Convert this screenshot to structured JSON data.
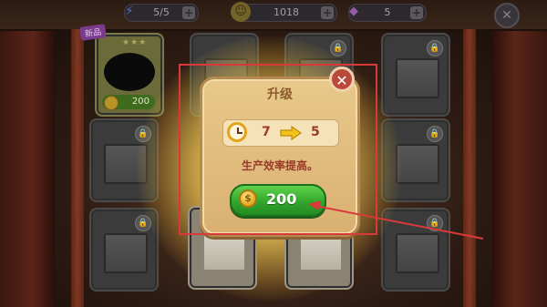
{
  "resources": {
    "energy": {
      "icon": "lightning-icon",
      "value": "5/5"
    },
    "coins": {
      "icon": "coin-icon",
      "value": "1018"
    },
    "gems": {
      "icon": "gem-icon",
      "value": "5"
    }
  },
  "top_close_glyph": "✕",
  "first_card": {
    "badge": "新品",
    "price": "200"
  },
  "dialog": {
    "title": "升级",
    "close_glyph": "✕",
    "timer_from": "7",
    "timer_to": "5",
    "description": "生产效率提高。",
    "button_coin_glyph": "$",
    "button_price": "200"
  },
  "colors": {
    "accent_green": "#2fa32a",
    "dialog_bg": "#e8c98a",
    "annotation_red": "#d83a3a",
    "close_red": "#b94a3a"
  }
}
